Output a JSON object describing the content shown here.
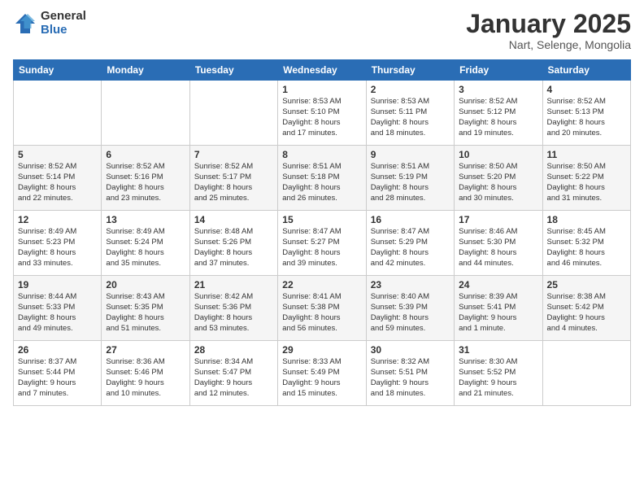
{
  "logo": {
    "general": "General",
    "blue": "Blue"
  },
  "title": "January 2025",
  "subtitle": "Nart, Selenge, Mongolia",
  "days_of_week": [
    "Sunday",
    "Monday",
    "Tuesday",
    "Wednesday",
    "Thursday",
    "Friday",
    "Saturday"
  ],
  "weeks": [
    [
      {
        "day": "",
        "info": ""
      },
      {
        "day": "",
        "info": ""
      },
      {
        "day": "",
        "info": ""
      },
      {
        "day": "1",
        "info": "Sunrise: 8:53 AM\nSunset: 5:10 PM\nDaylight: 8 hours\nand 17 minutes."
      },
      {
        "day": "2",
        "info": "Sunrise: 8:53 AM\nSunset: 5:11 PM\nDaylight: 8 hours\nand 18 minutes."
      },
      {
        "day": "3",
        "info": "Sunrise: 8:52 AM\nSunset: 5:12 PM\nDaylight: 8 hours\nand 19 minutes."
      },
      {
        "day": "4",
        "info": "Sunrise: 8:52 AM\nSunset: 5:13 PM\nDaylight: 8 hours\nand 20 minutes."
      }
    ],
    [
      {
        "day": "5",
        "info": "Sunrise: 8:52 AM\nSunset: 5:14 PM\nDaylight: 8 hours\nand 22 minutes."
      },
      {
        "day": "6",
        "info": "Sunrise: 8:52 AM\nSunset: 5:16 PM\nDaylight: 8 hours\nand 23 minutes."
      },
      {
        "day": "7",
        "info": "Sunrise: 8:52 AM\nSunset: 5:17 PM\nDaylight: 8 hours\nand 25 minutes."
      },
      {
        "day": "8",
        "info": "Sunrise: 8:51 AM\nSunset: 5:18 PM\nDaylight: 8 hours\nand 26 minutes."
      },
      {
        "day": "9",
        "info": "Sunrise: 8:51 AM\nSunset: 5:19 PM\nDaylight: 8 hours\nand 28 minutes."
      },
      {
        "day": "10",
        "info": "Sunrise: 8:50 AM\nSunset: 5:20 PM\nDaylight: 8 hours\nand 30 minutes."
      },
      {
        "day": "11",
        "info": "Sunrise: 8:50 AM\nSunset: 5:22 PM\nDaylight: 8 hours\nand 31 minutes."
      }
    ],
    [
      {
        "day": "12",
        "info": "Sunrise: 8:49 AM\nSunset: 5:23 PM\nDaylight: 8 hours\nand 33 minutes."
      },
      {
        "day": "13",
        "info": "Sunrise: 8:49 AM\nSunset: 5:24 PM\nDaylight: 8 hours\nand 35 minutes."
      },
      {
        "day": "14",
        "info": "Sunrise: 8:48 AM\nSunset: 5:26 PM\nDaylight: 8 hours\nand 37 minutes."
      },
      {
        "day": "15",
        "info": "Sunrise: 8:47 AM\nSunset: 5:27 PM\nDaylight: 8 hours\nand 39 minutes."
      },
      {
        "day": "16",
        "info": "Sunrise: 8:47 AM\nSunset: 5:29 PM\nDaylight: 8 hours\nand 42 minutes."
      },
      {
        "day": "17",
        "info": "Sunrise: 8:46 AM\nSunset: 5:30 PM\nDaylight: 8 hours\nand 44 minutes."
      },
      {
        "day": "18",
        "info": "Sunrise: 8:45 AM\nSunset: 5:32 PM\nDaylight: 8 hours\nand 46 minutes."
      }
    ],
    [
      {
        "day": "19",
        "info": "Sunrise: 8:44 AM\nSunset: 5:33 PM\nDaylight: 8 hours\nand 49 minutes."
      },
      {
        "day": "20",
        "info": "Sunrise: 8:43 AM\nSunset: 5:35 PM\nDaylight: 8 hours\nand 51 minutes."
      },
      {
        "day": "21",
        "info": "Sunrise: 8:42 AM\nSunset: 5:36 PM\nDaylight: 8 hours\nand 53 minutes."
      },
      {
        "day": "22",
        "info": "Sunrise: 8:41 AM\nSunset: 5:38 PM\nDaylight: 8 hours\nand 56 minutes."
      },
      {
        "day": "23",
        "info": "Sunrise: 8:40 AM\nSunset: 5:39 PM\nDaylight: 8 hours\nand 59 minutes."
      },
      {
        "day": "24",
        "info": "Sunrise: 8:39 AM\nSunset: 5:41 PM\nDaylight: 9 hours\nand 1 minute."
      },
      {
        "day": "25",
        "info": "Sunrise: 8:38 AM\nSunset: 5:42 PM\nDaylight: 9 hours\nand 4 minutes."
      }
    ],
    [
      {
        "day": "26",
        "info": "Sunrise: 8:37 AM\nSunset: 5:44 PM\nDaylight: 9 hours\nand 7 minutes."
      },
      {
        "day": "27",
        "info": "Sunrise: 8:36 AM\nSunset: 5:46 PM\nDaylight: 9 hours\nand 10 minutes."
      },
      {
        "day": "28",
        "info": "Sunrise: 8:34 AM\nSunset: 5:47 PM\nDaylight: 9 hours\nand 12 minutes."
      },
      {
        "day": "29",
        "info": "Sunrise: 8:33 AM\nSunset: 5:49 PM\nDaylight: 9 hours\nand 15 minutes."
      },
      {
        "day": "30",
        "info": "Sunrise: 8:32 AM\nSunset: 5:51 PM\nDaylight: 9 hours\nand 18 minutes."
      },
      {
        "day": "31",
        "info": "Sunrise: 8:30 AM\nSunset: 5:52 PM\nDaylight: 9 hours\nand 21 minutes."
      },
      {
        "day": "",
        "info": ""
      }
    ]
  ]
}
